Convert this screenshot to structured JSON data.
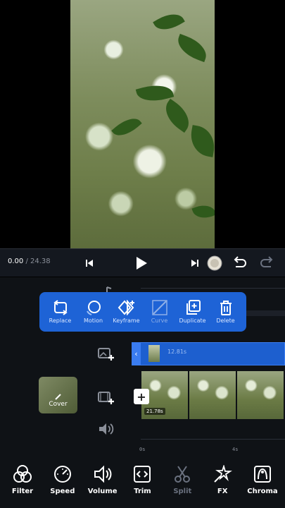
{
  "playback": {
    "current_time": "0.00",
    "separator": " / ",
    "total_time": "24.38"
  },
  "popup_menu": [
    {
      "label": "Replace",
      "icon": "replace-icon",
      "enabled": true
    },
    {
      "label": "Motion",
      "icon": "motion-icon",
      "enabled": true
    },
    {
      "label": "Keyframe",
      "icon": "keyframe-icon",
      "enabled": true
    },
    {
      "label": "Curve",
      "icon": "curve-icon",
      "enabled": false
    },
    {
      "label": "Duplicate",
      "icon": "duplicate-icon",
      "enabled": true
    },
    {
      "label": "Delete",
      "icon": "delete-icon",
      "enabled": true
    }
  ],
  "pip_clip": {
    "duration": "12.81s"
  },
  "cover": {
    "label": "Cover"
  },
  "main_clip": {
    "duration": "21.78s"
  },
  "ruler": {
    "ticks": [
      "0s",
      "4s"
    ]
  },
  "toolbar": [
    {
      "label": "Filter",
      "icon": "filter-icon",
      "enabled": true
    },
    {
      "label": "Speed",
      "icon": "speed-icon",
      "enabled": true
    },
    {
      "label": "Volume",
      "icon": "volume-icon",
      "enabled": true
    },
    {
      "label": "Trim",
      "icon": "trim-icon",
      "enabled": true
    },
    {
      "label": "Split",
      "icon": "split-icon",
      "enabled": false
    },
    {
      "label": "FX",
      "icon": "fx-icon",
      "enabled": true
    },
    {
      "label": "Chroma",
      "icon": "chroma-icon",
      "enabled": true
    }
  ],
  "colors": {
    "accent": "#1e63d6",
    "background": "#0f1216"
  }
}
